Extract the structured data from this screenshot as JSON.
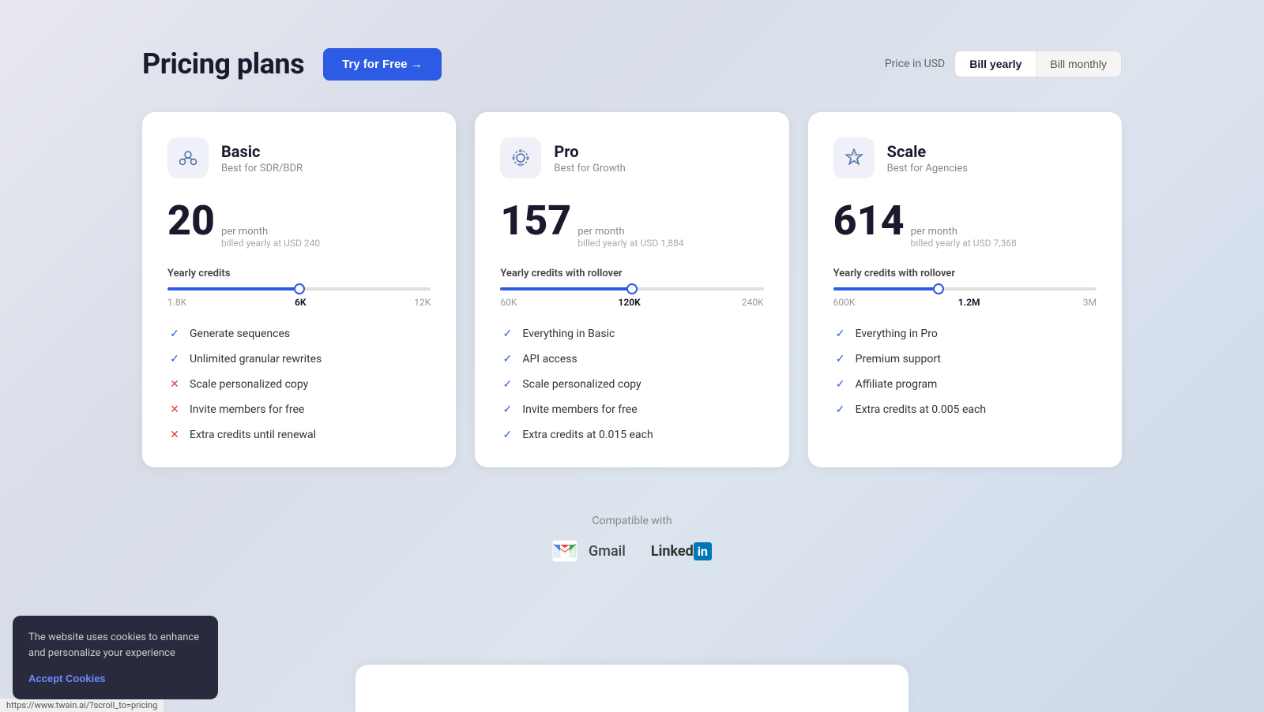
{
  "header": {
    "title": "Pricing plans",
    "try_free_btn": "Try for Free →",
    "price_label": "Price in USD",
    "bill_yearly": "Bill yearly",
    "bill_monthly": "Bill monthly"
  },
  "plans": [
    {
      "id": "basic",
      "name": "Basic",
      "subtitle": "Best for SDR/BDR",
      "price": "20",
      "per_month": "per month",
      "billed_yearly": "billed yearly at USD 240",
      "credits_label": "Yearly credits",
      "slider_min": "1.8K",
      "slider_mid": "6K",
      "slider_max": "12K",
      "slider_fill_pct": 50,
      "slider_thumb_pct": 50,
      "features": [
        {
          "text": "Generate sequences",
          "included": true
        },
        {
          "text": "Unlimited granular rewrites",
          "included": true
        },
        {
          "text": "Scale personalized copy",
          "included": false
        },
        {
          "text": "Invite members for free",
          "included": false
        },
        {
          "text": "Extra credits until renewal",
          "included": false
        }
      ]
    },
    {
      "id": "pro",
      "name": "Pro",
      "subtitle": "Best for Growth",
      "price": "157",
      "per_month": "per month",
      "billed_yearly": "billed yearly at USD 1,884",
      "credits_label": "Yearly credits with rollover",
      "slider_min": "60K",
      "slider_mid": "120K",
      "slider_max": "240K",
      "slider_fill_pct": 50,
      "slider_thumb_pct": 50,
      "features": [
        {
          "text": "Everything in Basic",
          "included": true
        },
        {
          "text": "API access",
          "included": true
        },
        {
          "text": "Scale personalized copy",
          "included": true
        },
        {
          "text": "Invite members for free",
          "included": true
        },
        {
          "text": "Extra credits at 0.015 each",
          "included": true
        }
      ]
    },
    {
      "id": "scale",
      "name": "Scale",
      "subtitle": "Best for Agencies",
      "price": "614",
      "per_month": "per month",
      "billed_yearly": "billed yearly at USD 7,368",
      "credits_label": "Yearly credits with rollover",
      "slider_min": "600K",
      "slider_mid": "1.2M",
      "slider_max": "3M",
      "slider_fill_pct": 40,
      "slider_thumb_pct": 40,
      "features": [
        {
          "text": "Everything in Pro",
          "included": true
        },
        {
          "text": "Premium support",
          "included": true
        },
        {
          "text": "Affiliate program",
          "included": true
        },
        {
          "text": "Extra credits at 0.005 each",
          "included": true
        }
      ]
    }
  ],
  "compatible": {
    "label": "Compatible with",
    "gmail": "Gmail",
    "linkedin": "Linked"
  },
  "cookie": {
    "text": "The website uses cookies to enhance and personalize your experience",
    "accept": "Accept Cookies"
  },
  "url": "https://www.twain.ai/?scroll_to=pricing"
}
